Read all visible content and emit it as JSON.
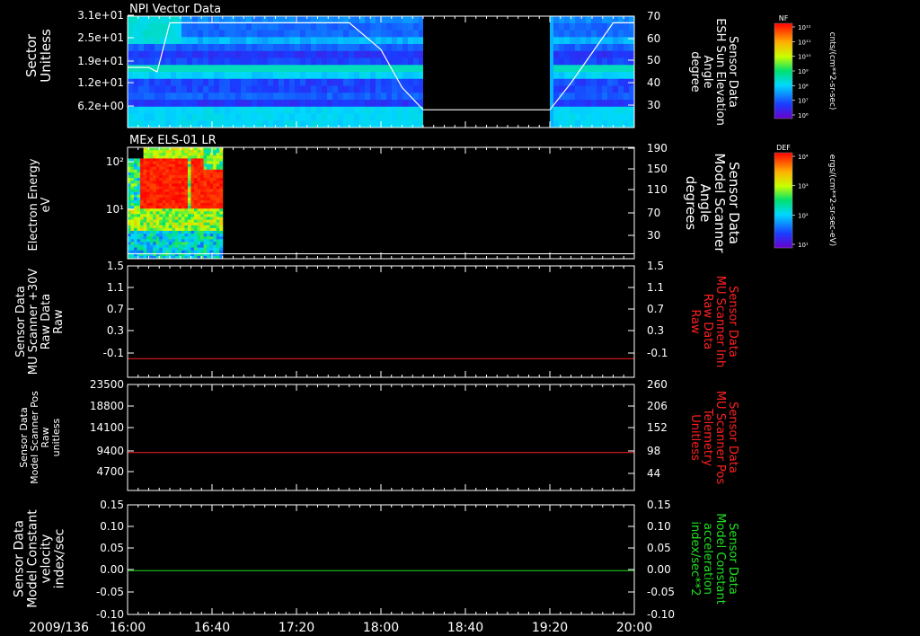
{
  "chart_data": [
    {
      "type": "heatmap",
      "title": "NPI Vector Data",
      "ylabel_left": [
        "Sector",
        "Unitless"
      ],
      "yticks_left": [
        "3.1e+01",
        "2.5e+01",
        "1.9e+01",
        "1.2e+01",
        "6.2e+00"
      ],
      "ylabel_right": [
        "Sensor Data",
        "ESH Sun Elevation",
        "Angle",
        "degree"
      ],
      "yticks_right": [
        "70",
        "60",
        "50",
        "40",
        "30"
      ],
      "ylim_right": [
        20,
        70
      ],
      "overlay_line": {
        "color": "#ffffff",
        "x": [
          "16:00",
          "16:10",
          "16:14",
          "16:20",
          "17:45",
          "18:00",
          "18:10",
          "18:20",
          "19:00",
          "19:20",
          "19:30",
          "19:50",
          "20:00"
        ],
        "y": [
          47,
          47,
          45,
          67,
          67,
          55,
          38,
          28,
          28,
          28,
          40,
          67,
          67
        ]
      },
      "data_gaps": [
        [
          "18:20",
          "19:20"
        ]
      ],
      "colorbar": {
        "label": "NF",
        "units": "cnts/(cm**2-sr-sec)",
        "ticks": [
          "10¹²",
          "10¹¹",
          "10¹⁰",
          "10⁹",
          "10⁸",
          "10⁷",
          "10⁶"
        ]
      }
    },
    {
      "type": "heatmap",
      "title": "MEx ELS-01 LR",
      "ylabel_left": [
        "Electron Energy",
        "eV"
      ],
      "yticks_left": [
        "10²",
        "10¹"
      ],
      "ylabel_right": [
        "Sensor Data",
        "Model Scanner",
        "Angle",
        "degrees"
      ],
      "yticks_right": [
        "190",
        "150",
        "110",
        "70",
        "30"
      ],
      "ylim_right": [
        10,
        190
      ],
      "overlay_line": {
        "color": "#ffffff",
        "value": 18
      },
      "data_extent": [
        "16:00",
        "16:45"
      ],
      "colorbar": {
        "label": "DEF",
        "units": "ergs/(cm**2-sr-sec-eV)",
        "ticks": [
          "10⁴",
          "10³",
          "10²",
          "10¹"
        ]
      }
    },
    {
      "type": "line",
      "ylabel_left": [
        "Sensor Data",
        "MU Scanner +30V",
        "Raw Data",
        "Raw"
      ],
      "yticks_left": [
        "1.5",
        "1.1",
        "0.7",
        "0.3",
        "-0.1"
      ],
      "ylim_left": [
        -0.3,
        1.5
      ],
      "ylabel_right": [
        "Sensor Data",
        "MU Scanner Inh",
        "Raw Data",
        "Raw"
      ],
      "yticks_right": [
        "1.5",
        "1.1",
        "0.7",
        "0.3",
        "-0.1"
      ],
      "right_label_color": "#ff2020",
      "series": [
        {
          "color": "#ff2020",
          "x": [
            "16:00",
            "20:00"
          ],
          "y": [
            0.0,
            0.0
          ]
        }
      ]
    },
    {
      "type": "line",
      "ylabel_left": [
        "Sensor Data",
        "Model Scanner Pos",
        "Raw",
        "unitless"
      ],
      "yticks_left": [
        "23500",
        "18800",
        "14100",
        "9400",
        "4700"
      ],
      "ylim_left": [
        0,
        23500
      ],
      "ylabel_right": [
        "Sensor Data",
        "MU Scanner Pos",
        "Telemetry",
        "Unitless"
      ],
      "yticks_right": [
        "260",
        "206",
        "152",
        "98",
        "44"
      ],
      "right_label_color": "#ff2020",
      "series": [
        {
          "color": "#ff2020",
          "x": [
            "16:00",
            "20:00"
          ],
          "y": [
            8400,
            8400
          ]
        }
      ]
    },
    {
      "type": "line",
      "ylabel_left": [
        "Sensor Data",
        "Model Constant",
        "velocity",
        "index/sec"
      ],
      "yticks_left": [
        "0.15",
        "0.10",
        "0.05",
        "0.00",
        "-0.05",
        "-0.10"
      ],
      "ylim_left": [
        -0.1,
        0.15
      ],
      "ylabel_right": [
        "Sensor Data",
        "Model Constant",
        "acceleration",
        "index/sec**2"
      ],
      "yticks_right": [
        "0.15",
        "0.10",
        "0.05",
        "0.00",
        "-0.05",
        "-0.10"
      ],
      "right_label_color": "#20e020",
      "series": [
        {
          "color": "#20e020",
          "x": [
            "16:00",
            "20:00"
          ],
          "y": [
            0.0,
            0.0
          ]
        }
      ]
    }
  ],
  "time_axis": {
    "date": "2009/136",
    "ticks": [
      "16:00",
      "16:40",
      "17:20",
      "18:00",
      "18:40",
      "19:20",
      "20:00"
    ]
  }
}
